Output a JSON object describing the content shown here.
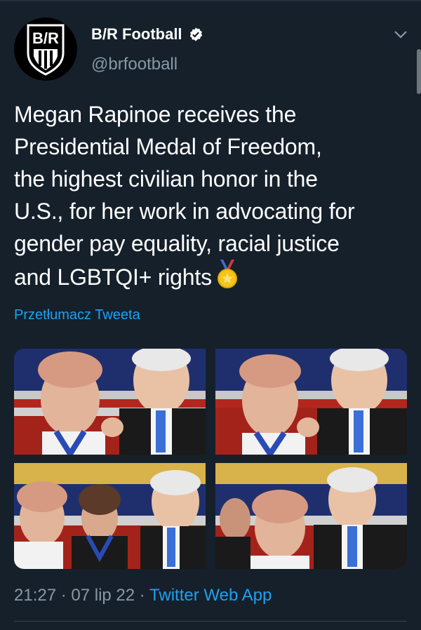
{
  "account": {
    "name": "B/R Football",
    "handle": "@brfootball",
    "avatar_text": "B/R",
    "verified": true
  },
  "tweet": {
    "text": "Megan Rapinoe receives the\nPresidential Medal of Freedom,\nthe highest civilian honor in the\nU.S., for her work in advocating for\ngender pay equality, racial justice\nand LGBTQI+ rights",
    "emoji_icon": "sports-medal-icon",
    "translate_label": "Przetłumacz Tweeta"
  },
  "media": {
    "count": 4,
    "photos": [
      {
        "name": "photo-1"
      },
      {
        "name": "photo-2"
      },
      {
        "name": "photo-3"
      },
      {
        "name": "photo-4"
      }
    ]
  },
  "meta": {
    "time": "21:27",
    "sep1": " · ",
    "date": "07 lip 22",
    "sep2": " · ",
    "source": "Twitter Web App"
  },
  "colors": {
    "background": "#15202b",
    "text": "#ffffff",
    "secondary": "#8899a6",
    "link": "#1da1f2"
  }
}
